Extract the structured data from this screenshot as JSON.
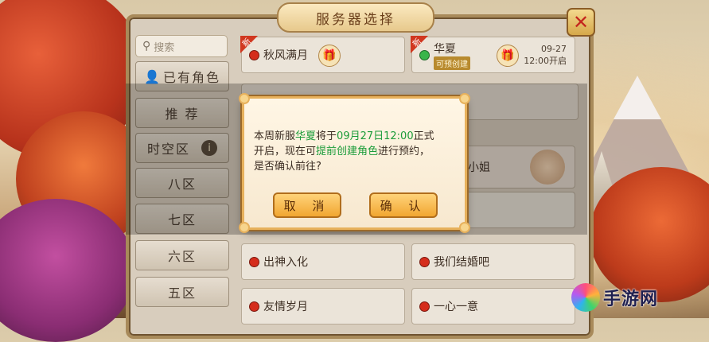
{
  "header": {
    "title": "服务器选择"
  },
  "sidebar": {
    "search_placeholder": "搜索",
    "items": [
      {
        "label": "已有角色"
      },
      {
        "label": "推 荐"
      },
      {
        "label": "时空区"
      },
      {
        "label": "八区"
      },
      {
        "label": "七区"
      },
      {
        "label": "六区"
      },
      {
        "label": "五区"
      }
    ]
  },
  "servers": {
    "featured": [
      {
        "name": "秋风满月",
        "tag": "新",
        "status_color": "#d52d1c"
      },
      {
        "name": "华夏",
        "tag": "新",
        "status_color": "#39b54a",
        "status_text": "可预创建",
        "open_date": "09-27",
        "open_time": "12:00开启"
      }
    ],
    "list": [
      {
        "name": "小姐"
      },
      {
        "name": "出神入化"
      },
      {
        "name": "我们结婚吧"
      },
      {
        "name": "友情岁月"
      },
      {
        "name": "一心一意"
      }
    ]
  },
  "modal": {
    "line1_prefix": "本周新服",
    "server": "华夏",
    "line1_mid": "将于",
    "datetime": "09月27日12:00",
    "line1_suffix": "正式",
    "line2_prefix": "开启，现在可",
    "action": "提前创建角色",
    "line2_suffix": "进行预约，",
    "line3": "是否确认前往?",
    "cancel_label": "取 消",
    "confirm_label": "确 认"
  },
  "watermark": {
    "text": "手游网"
  },
  "colors": {
    "accent_gold": "#e7b15c",
    "highlight_green": "#1c9c3a",
    "status_red": "#d52d1c"
  }
}
